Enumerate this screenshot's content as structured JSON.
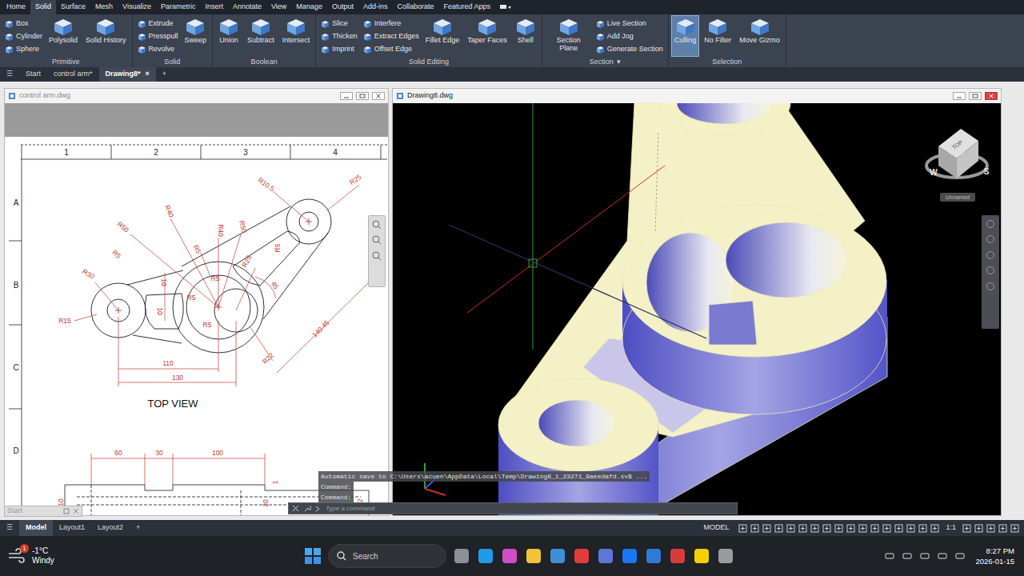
{
  "ribbon": {
    "tabs": [
      {
        "label": "Home",
        "selected": false
      },
      {
        "label": "Solid",
        "selected": true
      },
      {
        "label": "Surface",
        "selected": false
      },
      {
        "label": "Mesh",
        "selected": false
      },
      {
        "label": "Visualize",
        "selected": false
      },
      {
        "label": "Parametric",
        "selected": false
      },
      {
        "label": "Insert",
        "selected": false
      },
      {
        "label": "Annotate",
        "selected": false
      },
      {
        "label": "View",
        "selected": false
      },
      {
        "label": "Manage",
        "selected": false
      },
      {
        "label": "Output",
        "selected": false
      },
      {
        "label": "Add-ins",
        "selected": false
      },
      {
        "label": "Collaborate",
        "selected": false
      },
      {
        "label": "Featured Apps",
        "selected": false
      }
    ],
    "panels": [
      {
        "title": "Primitive",
        "groups": [
          {
            "kind": "small",
            "tools": [
              {
                "label": "Box",
                "selected": false
              },
              {
                "label": "Cylinder",
                "selected": false
              },
              {
                "label": "Sphere",
                "selected": false
              }
            ]
          },
          {
            "kind": "large",
            "tools": [
              {
                "label": "Polysolid",
                "selected": false
              },
              {
                "label": "Solid History",
                "selected": false
              }
            ]
          }
        ]
      },
      {
        "title": "Solid",
        "groups": [
          {
            "kind": "small",
            "tools": [
              {
                "label": "Extrude",
                "selected": false
              },
              {
                "label": "Presspull",
                "selected": false
              },
              {
                "label": "Revolve",
                "selected": false
              }
            ]
          },
          {
            "kind": "large",
            "tools": [
              {
                "label": "Sweep",
                "selected": false
              }
            ]
          }
        ]
      },
      {
        "title": "Boolean",
        "groups": [
          {
            "kind": "large",
            "tools": [
              {
                "label": "Union",
                "selected": false
              },
              {
                "label": "Subtract",
                "selected": false
              },
              {
                "label": "Intersect",
                "selected": false
              }
            ]
          }
        ]
      },
      {
        "title": "Solid Editing",
        "groups": [
          {
            "kind": "small",
            "tools": [
              {
                "label": "Slice",
                "selected": false
              },
              {
                "label": "Thicken",
                "selected": false
              },
              {
                "label": "Imprint",
                "selected": false
              }
            ]
          },
          {
            "kind": "small",
            "tools": [
              {
                "label": "Interfere",
                "selected": false
              },
              {
                "label": "Extract Edges",
                "selected": false
              },
              {
                "label": "Offset Edge",
                "selected": false
              }
            ]
          },
          {
            "kind": "large",
            "tools": [
              {
                "label": "Fillet Edge",
                "selected": false
              },
              {
                "label": "Taper Faces",
                "selected": false
              },
              {
                "label": "Shell",
                "selected": false
              }
            ]
          }
        ]
      },
      {
        "title": "Section",
        "title_menu": "▾",
        "groups": [
          {
            "kind": "large",
            "tools": [
              {
                "label": "Section Plane",
                "selected": false
              }
            ]
          },
          {
            "kind": "small",
            "tools": [
              {
                "label": "Live Section",
                "selected": false
              },
              {
                "label": "Add Jog",
                "selected": false
              },
              {
                "label": "Generate Section",
                "selected": false
              }
            ]
          }
        ]
      },
      {
        "title": "Selection",
        "groups": [
          {
            "kind": "large",
            "tools": [
              {
                "label": "Culling",
                "selected": true
              },
              {
                "label": "No Filter",
                "selected": false
              },
              {
                "label": "Move Gizmo",
                "selected": false
              }
            ]
          }
        ]
      }
    ]
  },
  "file_tabs": {
    "menu": "☰",
    "tabs": [
      {
        "label": "Start",
        "selected": false
      },
      {
        "label": "control arm*",
        "selected": false
      },
      {
        "label": "Drawing8*",
        "selected": true,
        "close": "×"
      }
    ],
    "add": "+"
  },
  "windows": [
    {
      "title": "control arm.dwg",
      "active": false
    },
    {
      "title": "Drawing8.dwg",
      "active": true
    }
  ],
  "minimized": {
    "title": "Start"
  },
  "drawing": {
    "column_labels": [
      "1",
      "2",
      "3",
      "4"
    ],
    "row_labels": [
      "A",
      "B",
      "C",
      "D"
    ],
    "dimensions": [
      "R10.5",
      "R25",
      "R40",
      "R50",
      "R40",
      "R50",
      "R5",
      "R5",
      "R30",
      "10",
      "R5",
      "R25",
      "R5",
      "45",
      "10",
      "R5",
      "R5",
      "R15",
      "140.45",
      "R22",
      "110",
      "130"
    ],
    "view_title": "TOP VIEW",
    "lower_dimensions": [
      "60",
      "30",
      "100",
      "1",
      "10",
      "20",
      "22"
    ]
  },
  "viewport": {
    "axis_labels": [
      "x",
      "z"
    ],
    "viewcube": {
      "face": "TOP",
      "west": "W",
      "south": "S",
      "view_name": "Unnamed"
    }
  },
  "command_line": {
    "history": [
      "Automatic save to C:\\Users\\acuen\\AppData\\Local\\Temp\\Drawing8_1_23271_9aeedafd.sv$ ...",
      "Command:",
      "Command:"
    ],
    "placeholder": "Type a command"
  },
  "status_bar": {
    "menu": "☰",
    "layouts": [
      {
        "label": "Model",
        "selected": true
      },
      {
        "label": "Layout1",
        "selected": false
      },
      {
        "label": "Layout2",
        "selected": false
      }
    ],
    "add": "+",
    "space": "MODEL",
    "scale": "1:1"
  },
  "taskbar": {
    "weather": {
      "temperature": "-1°C",
      "condition": "Windy",
      "badge": "1"
    },
    "search": {
      "placeholder": "Search"
    },
    "clock": {
      "time": "8:27 PM",
      "date": "2026-01-15"
    }
  }
}
